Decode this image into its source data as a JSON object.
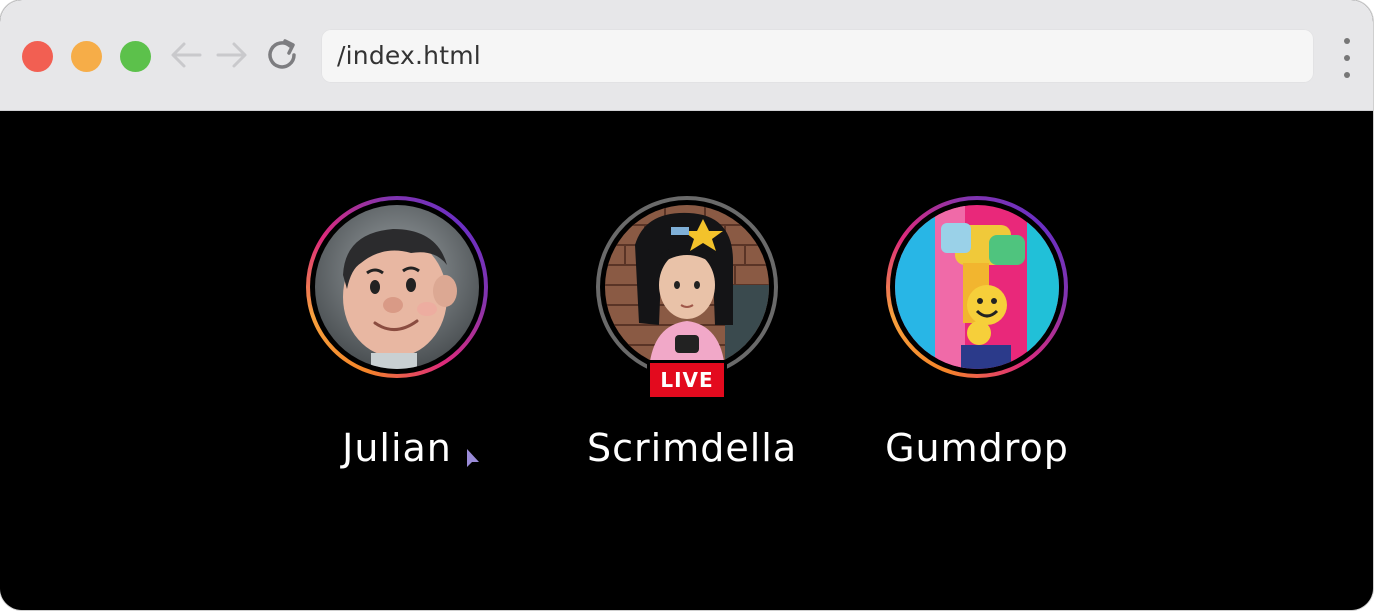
{
  "browser": {
    "url": "/index.html",
    "buttons": {
      "close": "close",
      "minimize": "minimize",
      "maximize": "maximize"
    },
    "icons": {
      "back": "arrow-left-icon",
      "forward": "arrow-right-icon",
      "reload": "reload-icon",
      "menu": "kebab-menu-icon"
    }
  },
  "stories": [
    {
      "name": "Julian",
      "live": false,
      "ring": "gradient"
    },
    {
      "name": "Scrimdella",
      "live": true,
      "ring": "grey",
      "badge": "LIVE"
    },
    {
      "name": "Gumdrop",
      "live": false,
      "ring": "gradient"
    }
  ],
  "colors": {
    "live_badge": "#e30a1e",
    "ring_start": "#f58529",
    "ring_end": "#8134af",
    "background": "#000000"
  }
}
